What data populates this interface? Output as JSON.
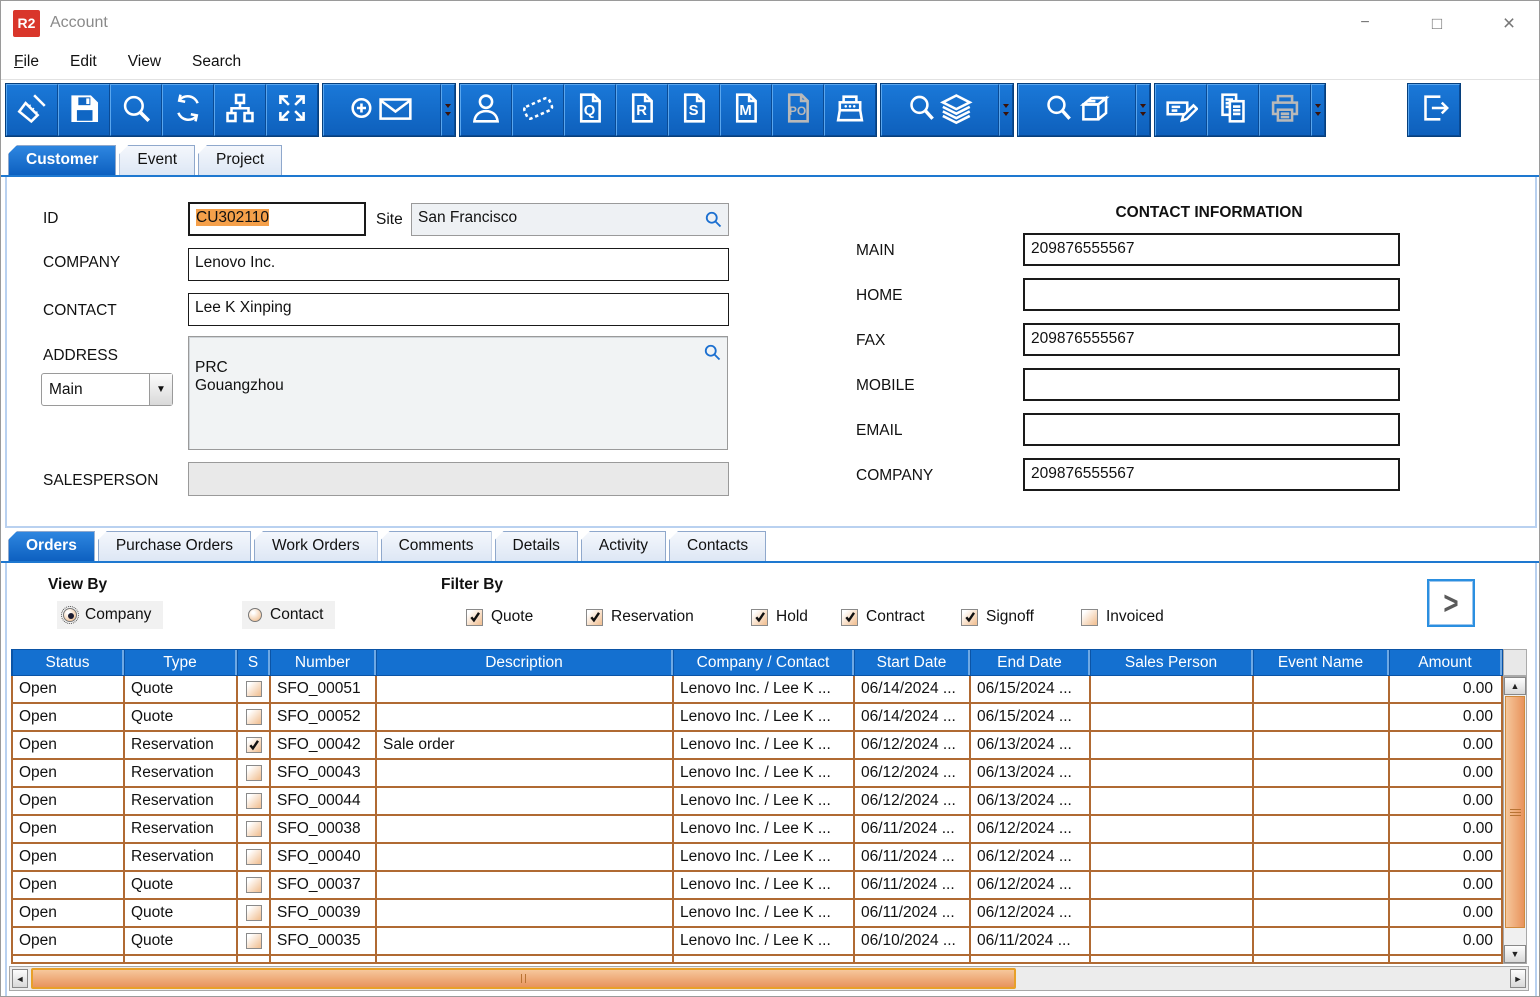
{
  "window": {
    "title": "Account",
    "logo": "R2"
  },
  "menu": [
    {
      "label": "File",
      "alt_underline": true
    },
    {
      "label": "Edit"
    },
    {
      "label": "View"
    },
    {
      "label": "Search"
    }
  ],
  "toolbar": {
    "groups": [
      {
        "buttons": [
          {
            "icon": "clean-icon",
            "name": "clean-button"
          },
          {
            "icon": "save-icon",
            "name": "save-button"
          },
          {
            "icon": "search-icon",
            "name": "search-button"
          },
          {
            "icon": "refresh-icon",
            "name": "refresh-button"
          },
          {
            "icon": "hierarchy-icon",
            "name": "hierarchy-button"
          },
          {
            "icon": "expand-icon",
            "name": "expand-button"
          }
        ]
      },
      {
        "separator": true,
        "buttons": [
          {
            "icon": "new-mail-icon",
            "name": "new-mail-button",
            "wide": true
          }
        ]
      },
      {
        "buttons": [
          {
            "icon": "contact-icon",
            "name": "contact-button"
          },
          {
            "icon": "ticket-icon",
            "name": "ticket-button"
          },
          {
            "icon": "quote-doc-icon",
            "name": "quote-document-button"
          },
          {
            "icon": "reservation-doc-icon",
            "name": "reservation-document-button"
          },
          {
            "icon": "sale-doc-icon",
            "name": "sale-document-button"
          },
          {
            "icon": "misc-doc-icon",
            "name": "misc-document-button"
          },
          {
            "icon": "po-doc-icon",
            "name": "purchase-order-document-button",
            "disabled": true
          },
          {
            "icon": "register-icon",
            "name": "register-button"
          }
        ]
      },
      {
        "separator": true,
        "buttons": [
          {
            "icon": "search-stock-icon",
            "name": "search-stock-button",
            "wide": true
          }
        ]
      },
      {
        "separator": true,
        "buttons": [
          {
            "icon": "search-item-icon",
            "name": "search-item-button",
            "wide": true
          }
        ]
      },
      {
        "separator": true,
        "buttons": [
          {
            "icon": "edit-icon",
            "name": "edit-button"
          },
          {
            "icon": "copy-icon",
            "name": "copy-button"
          },
          {
            "icon": "print-icon",
            "name": "print-button",
            "disabled": true
          }
        ]
      }
    ],
    "exit_button": {
      "icon": "exit-icon",
      "name": "exit-button"
    }
  },
  "main_tabs": [
    {
      "label": "Customer",
      "active": true
    },
    {
      "label": "Event"
    },
    {
      "label": "Project"
    }
  ],
  "form": {
    "id": {
      "label": "ID",
      "value": "CU302110"
    },
    "site": {
      "label": "Site",
      "value": "San Francisco"
    },
    "company": {
      "label": "COMPANY",
      "value": "Lenovo Inc."
    },
    "contact": {
      "label": "CONTACT",
      "value": "Lee K Xinping"
    },
    "address": {
      "label": "ADDRESS",
      "value": "PRC\nGouangzhou",
      "type_selected": "Main"
    },
    "salesperson": {
      "label": "SALESPERSON",
      "value": ""
    }
  },
  "contact_info": {
    "title": "CONTACT INFORMATION",
    "fields": [
      {
        "label": "MAIN",
        "value": "209876555567"
      },
      {
        "label": "HOME",
        "value": ""
      },
      {
        "label": "FAX",
        "value": "209876555567"
      },
      {
        "label": "MOBILE",
        "value": ""
      },
      {
        "label": "EMAIL",
        "value": ""
      },
      {
        "label": "COMPANY",
        "value": "209876555567"
      }
    ]
  },
  "sub_tabs": [
    {
      "label": "Orders",
      "active": true
    },
    {
      "label": "Purchase Orders"
    },
    {
      "label": "Work Orders"
    },
    {
      "label": "Comments"
    },
    {
      "label": "Details"
    },
    {
      "label": "Activity"
    },
    {
      "label": "Contacts"
    }
  ],
  "view_by": {
    "title": "View By",
    "options": [
      {
        "label": "Company",
        "selected": true
      },
      {
        "label": "Contact",
        "selected": false
      }
    ]
  },
  "filter_by": {
    "title": "Filter By",
    "options": [
      {
        "label": "Quote",
        "checked": true
      },
      {
        "label": "Reservation",
        "checked": true
      },
      {
        "label": "Hold",
        "checked": true
      },
      {
        "label": "Contract",
        "checked": true
      },
      {
        "label": "Signoff",
        "checked": true
      },
      {
        "label": "Invoiced",
        "checked": false
      }
    ]
  },
  "next_button_label": ">",
  "table": {
    "columns": [
      "Status",
      "Type",
      "S",
      "Number",
      "Description",
      "Company / Contact",
      "Start Date",
      "End Date",
      "Sales Person",
      "Event Name",
      "Amount"
    ],
    "rows": [
      {
        "status": "Open",
        "type": "Quote",
        "s": false,
        "number": "SFO_00051",
        "description": "",
        "company_contact": "Lenovo Inc. / Lee K ...",
        "start_date": "06/14/2024 ...",
        "end_date": "06/15/2024 ...",
        "sales_person": "",
        "event_name": "",
        "amount": "0.00"
      },
      {
        "status": "Open",
        "type": "Quote",
        "s": false,
        "number": "SFO_00052",
        "description": "",
        "company_contact": "Lenovo Inc. / Lee K ...",
        "start_date": "06/14/2024 ...",
        "end_date": "06/15/2024 ...",
        "sales_person": "",
        "event_name": "",
        "amount": "0.00"
      },
      {
        "status": "Open",
        "type": "Reservation",
        "s": true,
        "number": "SFO_00042",
        "description": "Sale order",
        "company_contact": "Lenovo Inc. / Lee K ...",
        "start_date": "06/12/2024 ...",
        "end_date": "06/13/2024 ...",
        "sales_person": "",
        "event_name": "",
        "amount": "0.00"
      },
      {
        "status": "Open",
        "type": "Reservation",
        "s": false,
        "number": "SFO_00043",
        "description": "",
        "company_contact": "Lenovo Inc. / Lee K ...",
        "start_date": "06/12/2024 ...",
        "end_date": "06/13/2024 ...",
        "sales_person": "",
        "event_name": "",
        "amount": "0.00"
      },
      {
        "status": "Open",
        "type": "Reservation",
        "s": false,
        "number": "SFO_00044",
        "description": "",
        "company_contact": "Lenovo Inc. / Lee K ...",
        "start_date": "06/12/2024 ...",
        "end_date": "06/13/2024 ...",
        "sales_person": "",
        "event_name": "",
        "amount": "0.00"
      },
      {
        "status": "Open",
        "type": "Reservation",
        "s": false,
        "number": "SFO_00038",
        "description": "",
        "company_contact": "Lenovo Inc. / Lee K ...",
        "start_date": "06/11/2024 ...",
        "end_date": "06/12/2024 ...",
        "sales_person": "",
        "event_name": "",
        "amount": "0.00"
      },
      {
        "status": "Open",
        "type": "Reservation",
        "s": false,
        "number": "SFO_00040",
        "description": "",
        "company_contact": "Lenovo Inc. / Lee K ...",
        "start_date": "06/11/2024 ...",
        "end_date": "06/12/2024 ...",
        "sales_person": "",
        "event_name": "",
        "amount": "0.00"
      },
      {
        "status": "Open",
        "type": "Quote",
        "s": false,
        "number": "SFO_00037",
        "description": "",
        "company_contact": "Lenovo Inc. / Lee K ...",
        "start_date": "06/11/2024 ...",
        "end_date": "06/12/2024 ...",
        "sales_person": "",
        "event_name": "",
        "amount": "0.00"
      },
      {
        "status": "Open",
        "type": "Quote",
        "s": false,
        "number": "SFO_00039",
        "description": "",
        "company_contact": "Lenovo Inc. / Lee K ...",
        "start_date": "06/11/2024 ...",
        "end_date": "06/12/2024 ...",
        "sales_person": "",
        "event_name": "",
        "amount": "0.00"
      },
      {
        "status": "Open",
        "type": "Quote",
        "s": false,
        "number": "SFO_00035",
        "description": "",
        "company_contact": "Lenovo Inc. / Lee K ...",
        "start_date": "06/10/2024 ...",
        "end_date": "06/11/2024 ...",
        "sales_person": "",
        "event_name": "",
        "amount": "0.00"
      }
    ]
  },
  "colors": {
    "toolbar_blue": "#0f66c4",
    "active_tab_blue": "#0d60c0",
    "selection_orange": "#f5a04a",
    "row_border_brown": "#b06a33",
    "scroll_thumb_orange": "#eda365",
    "logo_red": "#d9362b"
  }
}
